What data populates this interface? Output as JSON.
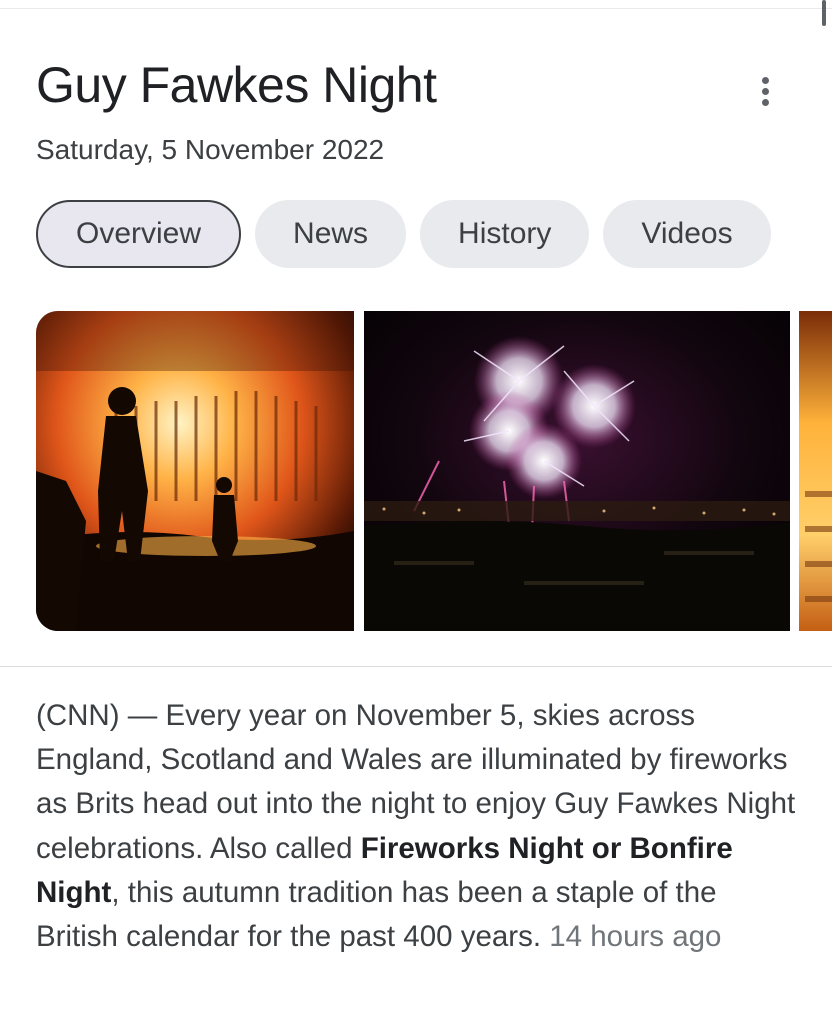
{
  "header": {
    "title": "Guy Fawkes Night",
    "date": "Saturday, 5 November 2022",
    "menu_icon": "more-vert-icon"
  },
  "tabs": [
    {
      "label": "Overview",
      "active": true
    },
    {
      "label": "News",
      "active": false
    },
    {
      "label": "History",
      "active": false
    },
    {
      "label": "Videos",
      "active": false
    }
  ],
  "images": [
    {
      "subject": "silhouettes in front of a bonfire"
    },
    {
      "subject": "fireworks over a city at night"
    },
    {
      "subject": "bonfire (partially visible)"
    }
  ],
  "snippet": {
    "source_intro": "(CNN) — Every year on November 5, skies across England, Scotland and Wales are illuminated by fireworks as Brits head out into the night to enjoy Guy Fawkes Night celebrations. Also called ",
    "bold": "Fireworks Night or Bonfire Night",
    "rest": ", this autumn tradition has been a staple of the British calendar for the past 400 years. ",
    "time": "14 hours ago"
  },
  "colors": {
    "text": "#202124",
    "secondary": "#3c4043",
    "muted": "#70757a",
    "chip_bg": "#e8eaed"
  }
}
